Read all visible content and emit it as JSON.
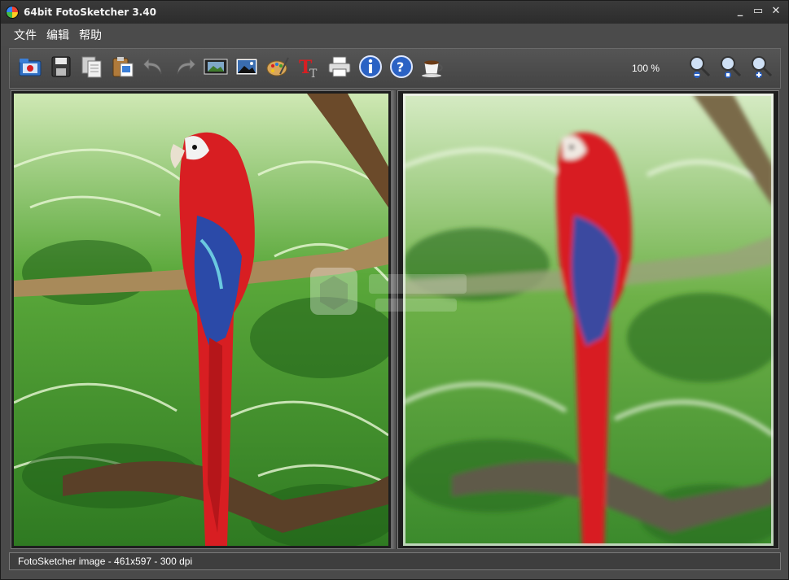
{
  "window": {
    "title": "64bit FotoSketcher 3.40"
  },
  "window_controls": {
    "minimize": "_",
    "maximize": "▭",
    "close": "✕"
  },
  "menu": {
    "items": [
      {
        "label": "文件"
      },
      {
        "label": "编辑"
      },
      {
        "label": "帮助"
      }
    ]
  },
  "toolbar": {
    "buttons": [
      {
        "icon": "open-folder-icon"
      },
      {
        "icon": "save-icon"
      },
      {
        "icon": "copy-icon"
      },
      {
        "icon": "paste-icon"
      },
      {
        "icon": "undo-icon"
      },
      {
        "icon": "redo-icon"
      },
      {
        "icon": "film-strip-icon"
      },
      {
        "icon": "picture-icon"
      },
      {
        "icon": "palette-icon"
      },
      {
        "icon": "text-icon"
      },
      {
        "icon": "print-icon"
      },
      {
        "icon": "info-icon"
      },
      {
        "icon": "help-icon"
      },
      {
        "icon": "coffee-cup-icon"
      }
    ],
    "zoom_level": "100 %",
    "zoom_buttons": [
      {
        "icon": "zoom-out-icon"
      },
      {
        "icon": "zoom-fit-icon"
      },
      {
        "icon": "zoom-in-icon"
      }
    ]
  },
  "status": {
    "text": "FotoSketcher image - 461x597 - 300 dpi"
  },
  "colors": {
    "accent_red": "#d81e22",
    "parrot_blue": "#2b4aa8",
    "foliage_green": "#3f9a2c",
    "chrome_dark": "#4a4a4a"
  }
}
